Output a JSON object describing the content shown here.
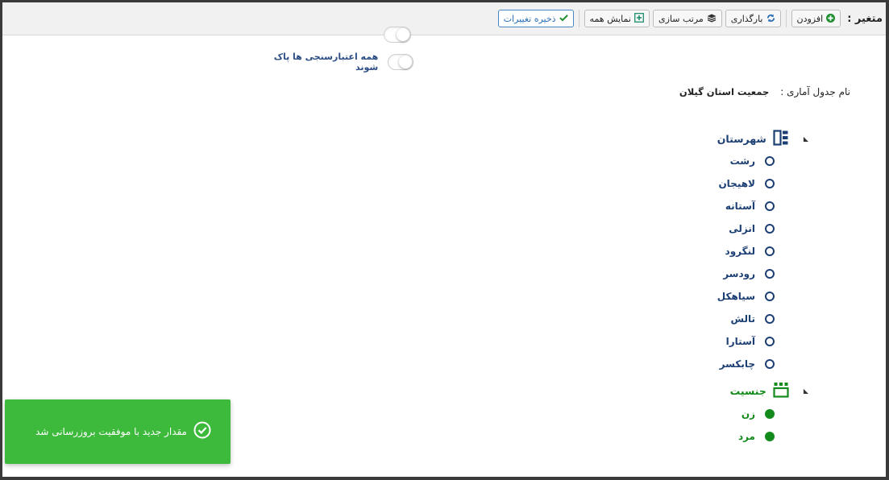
{
  "toolbar": {
    "label": "متغیر :",
    "buttons": [
      {
        "label": "افزودن",
        "icon": "plus-circle-icon"
      },
      {
        "label": "بارگذاری",
        "icon": "refresh-icon"
      },
      {
        "label": "مرتب سازی",
        "icon": "layers-icon"
      },
      {
        "label": "نمایش همه",
        "icon": "expand-icon"
      },
      {
        "label": "ذخیره تغییرات",
        "icon": "check-icon"
      }
    ]
  },
  "toggles": [
    {
      "label": "همه اعتبارسنجی ها پاک شوند",
      "on": false
    }
  ],
  "table": {
    "label": "نام جدول آماری :",
    "value": "جمعیت استان گیلان"
  },
  "categories": [
    {
      "name": "شهرستان",
      "icon": "columns-icon",
      "color": "#1c3f73",
      "items": [
        "رشت",
        "لاهیجان",
        "آستانه",
        "انزلی",
        "لنگرود",
        "رودسر",
        "سیاهکل",
        "تالش",
        "آستارا",
        "چابکسر"
      ],
      "filled": false
    },
    {
      "name": "جنسیت",
      "icon": "grid-icon",
      "color": "#138a1c",
      "items": [
        "زن",
        "مرد"
      ],
      "filled": true
    }
  ],
  "toast": {
    "message": "مقدار جدید با موفقیت بروزرسانی شد",
    "icon": "check-circle-icon",
    "color": "#3dba3b"
  }
}
